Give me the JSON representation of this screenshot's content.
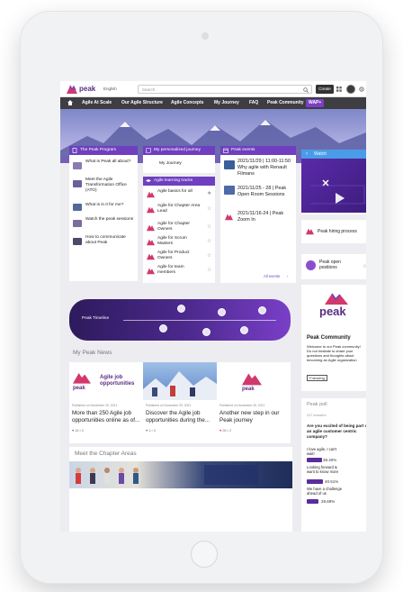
{
  "topbar": {
    "logo_text": "peak",
    "language": "English",
    "search_placeholder": "Search",
    "create_label": "Create"
  },
  "nav": {
    "items": [
      "Agile At Scale",
      "Our Agile Structure",
      "Agile Concepts",
      "My Journey",
      "FAQ",
      "Peak Community"
    ],
    "badge": "WAP+"
  },
  "program": {
    "title": "The Peak Program",
    "items": [
      "What is Peak all about?",
      "Meet the Agile Transformation Office (ATO)",
      "What is in it for me?",
      "Watch the peak sessions",
      "How to communicate about Peak"
    ]
  },
  "journey": {
    "title": "My personalized journey",
    "item": "My Journey"
  },
  "tracks": {
    "title": "Agile learning tracks",
    "items": [
      "Agile basics for all",
      "Agile for Chapter Area Lead",
      "Agile for Chapter Owners",
      "Agile for Scrum Masters",
      "Agile for Product Owners",
      "Agile for team members"
    ]
  },
  "events": {
    "title": "Peak events",
    "items": [
      "2021/11/29 | 11:00-11:50 Why agile with Renault Filmans",
      "2021/11/25 - 28 | Peak Open Room Sessions",
      "2021/11/16-24 | Peak Zoom In"
    ],
    "all_label": "All events"
  },
  "watch": {
    "title": "Watch",
    "hiring": "Peak hiring process",
    "open_positions": "Peak open positions"
  },
  "timeline": {
    "label": "Peak Timeline"
  },
  "news": {
    "section_title": "My Peak News",
    "cards": [
      {
        "logo_text": "peak",
        "tagline": "Agile job opportunities",
        "meta": "Published on November 29, 2021",
        "title": "More than 250 Agile job opportunities online as of...",
        "likes": "16",
        "comments": "0"
      },
      {
        "meta": "Published on November 25, 2021",
        "title": "Discover the Agile job opportunities during the...",
        "likes": "1",
        "comments": "0"
      },
      {
        "logo_text": "peak",
        "meta": "Published on November 25, 2021",
        "title": "Another new step in our Peak journey",
        "likes": "26",
        "comments": "2"
      }
    ]
  },
  "chapters": {
    "section_title": "Meet the Chapter Areas"
  },
  "community": {
    "logo_text": "peak",
    "title": "Peak Community",
    "desc": "Welcome to our Peak community! Do not hesitate to share your questions and thoughts about becoming an Agile organization",
    "following": "Following"
  },
  "poll": {
    "title": "Peak poll",
    "answers": "237 answers",
    "question": "Are you excited of being part of an agile customer centric company?",
    "options": [
      {
        "label": "I love agile, I can't wait!",
        "pct_label": "38.40%",
        "pct": 38.4
      },
      {
        "label": "Looking forward & want to know more",
        "pct_label": "40.51%",
        "pct": 40.51
      },
      {
        "label": "We have a challenge ahead of us",
        "pct_label": "29.69%",
        "pct": 29.69
      }
    ]
  },
  "colors": {
    "brand_purple": "#6f3fbf",
    "nav_dark": "#3d3d42",
    "watch_blue": "#4a9ce8",
    "logo_pink": "#d2386c"
  }
}
